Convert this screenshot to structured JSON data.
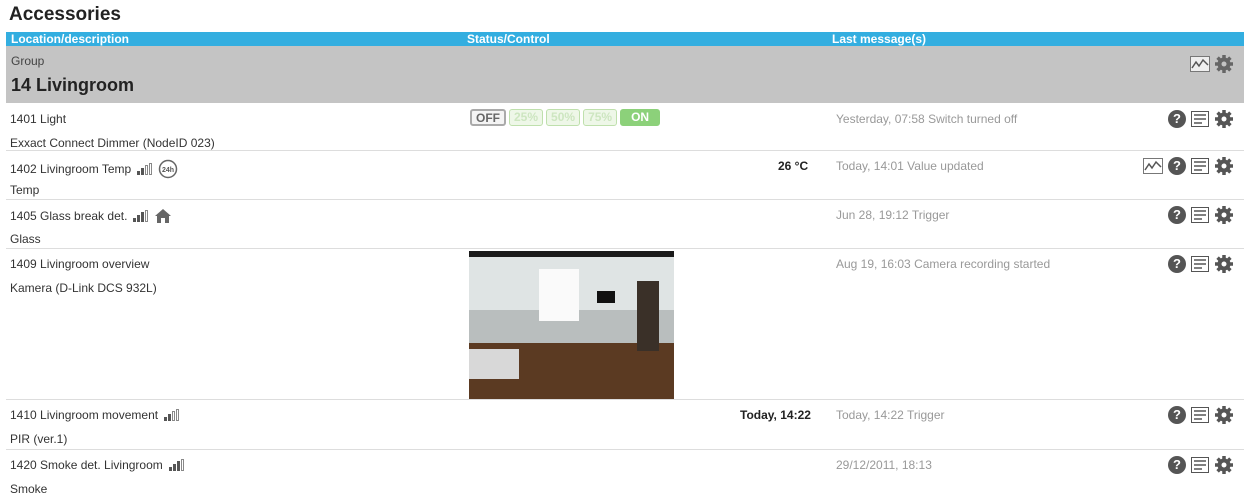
{
  "page": {
    "title": "Accessories"
  },
  "columns": {
    "location": "Location/description",
    "status": "Status/Control",
    "last": "Last message(s)"
  },
  "group": {
    "label": "Group",
    "name": "14 Livingroom"
  },
  "rows": [
    {
      "name": "1401 Light",
      "desc": "Exxact Connect Dimmer (NodeID 023)",
      "msg": "Yesterday, 07:58 Switch turned off",
      "buttons": [
        "OFF",
        "25%",
        "50%",
        "75%",
        "ON"
      ]
    },
    {
      "name": "1402 Livingroom Temp",
      "desc": "Temp",
      "msg": "Today, 14:01 Value updated",
      "status": "26 °C",
      "badge": "24h"
    },
    {
      "name": "1405 Glass break det.",
      "desc": "Glass",
      "msg": "Jun 28, 19:12 Trigger"
    },
    {
      "name": "1409 Livingroom overview",
      "desc": "Kamera (D-Link DCS 932L)",
      "msg": "Aug 19, 16:03 Camera recording started"
    },
    {
      "name": "1410 Livingroom movement",
      "desc": "PIR (ver.1)",
      "msg": "Today, 14:22 Trigger",
      "status": "Today, 14:22"
    },
    {
      "name": "1420 Smoke det. Livingroom",
      "desc": "Smoke",
      "msg": "29/12/2011, 18:13"
    }
  ],
  "icons": {
    "help": "?",
    "log": "log-icon",
    "settings": "gear-icon",
    "graph": "graph-icon",
    "home": "home-icon"
  },
  "colors": {
    "header": "#33aee0",
    "group": "#c4c4c4",
    "on_button": "#8cd17a"
  }
}
